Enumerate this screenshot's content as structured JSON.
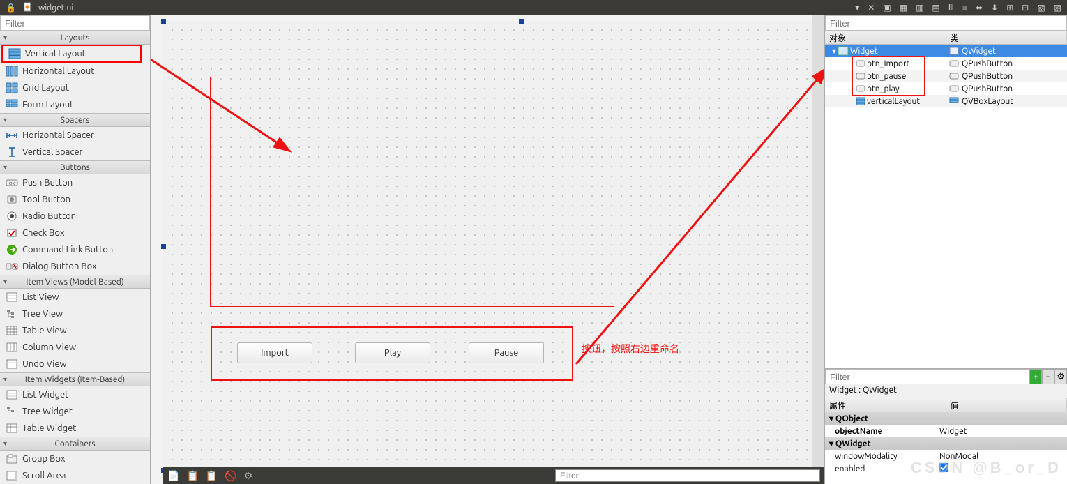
{
  "titlebar": {
    "filename": "widget.ui"
  },
  "widgetbox": {
    "filter_ph": "Filter",
    "categories": {
      "layouts": {
        "header": "Layouts",
        "items": [
          "Vertical Layout",
          "Horizontal Layout",
          "Grid Layout",
          "Form Layout"
        ]
      },
      "spacers": {
        "header": "Spacers",
        "items": [
          "Horizontal Spacer",
          "Vertical Spacer"
        ]
      },
      "buttons": {
        "header": "Buttons",
        "items": [
          "Push Button",
          "Tool Button",
          "Radio Button",
          "Check Box",
          "Command Link Button",
          "Dialog Button Box"
        ]
      },
      "itemviews": {
        "header": "Item Views (Model-Based)",
        "items": [
          "List View",
          "Tree View",
          "Table View",
          "Column View",
          "Undo View"
        ]
      },
      "itemwidgets": {
        "header": "Item Widgets (Item-Based)",
        "items": [
          "List Widget",
          "Tree Widget",
          "Table Widget"
        ]
      },
      "containers": {
        "header": "Containers",
        "items": [
          "Group Box",
          "Scroll Area"
        ]
      }
    }
  },
  "canvas": {
    "buttons": {
      "import": "Import",
      "play": "Play",
      "pause": "Pause"
    },
    "annotation": "按钮，按照右边重命名"
  },
  "inspector": {
    "filter_ph": "Filter",
    "cols": {
      "object": "对象",
      "class": "类"
    },
    "rows": [
      {
        "name": "Widget",
        "cls": "QWidget",
        "indent": 0,
        "icon": "form",
        "sel": true
      },
      {
        "name": "btn_Import",
        "cls": "QPushButton",
        "indent": 1,
        "icon": "btn"
      },
      {
        "name": "btn_pause",
        "cls": "QPushButton",
        "indent": 1,
        "icon": "btn"
      },
      {
        "name": "btn_play",
        "cls": "QPushButton",
        "indent": 1,
        "icon": "btn"
      },
      {
        "name": "verticalLayout",
        "cls": "QVBoxLayout",
        "indent": 1,
        "icon": "vlayout"
      }
    ]
  },
  "props": {
    "filter_ph": "Filter",
    "title": "Widget : QWidget",
    "cols": {
      "prop": "属性",
      "val": "值"
    },
    "cat1": "QObject",
    "objectName": {
      "k": "objectName",
      "v": "Widget"
    },
    "cat2": "QWidget",
    "windowModality": {
      "k": "windowModality",
      "v": "NonModal"
    },
    "enabled": {
      "k": "enabled",
      "v": "✓"
    }
  },
  "status": {
    "filter_ph": "Filter"
  }
}
